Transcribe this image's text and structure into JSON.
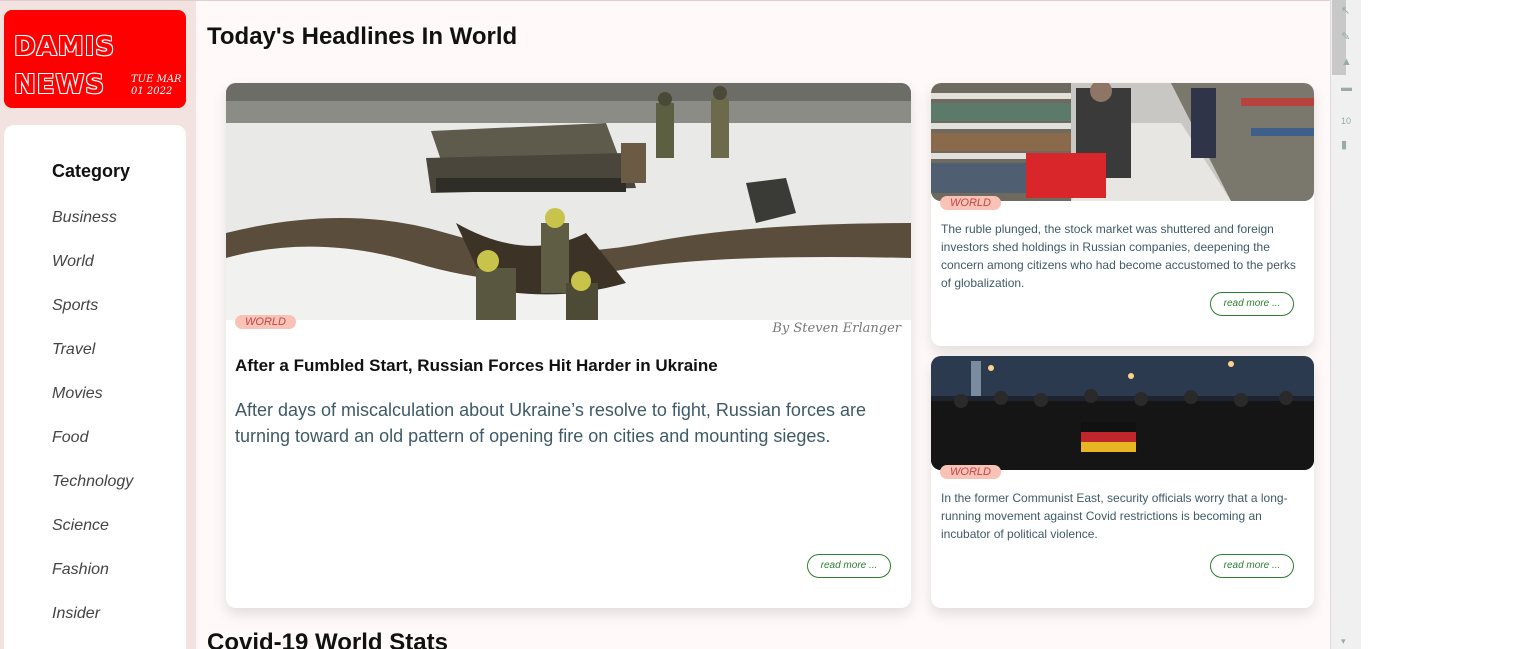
{
  "brand": {
    "line1": "DAMIS",
    "line2": "NEWS",
    "date_line1": "TUE MAR",
    "date_line2": "01 2022",
    "accent": "#ff0000"
  },
  "sidebar": {
    "title": "Category",
    "items": [
      "Business",
      "World",
      "Sports",
      "Travel",
      "Movies",
      "Food",
      "Technology",
      "Science",
      "Fashion",
      "Insider"
    ]
  },
  "main": {
    "heading": "Today's Headlines In World",
    "next_heading": "Covid-19 World Stats",
    "featured": {
      "badge": "WORLD",
      "byline": "By Steven Erlanger",
      "title": "After a Fumbled Start, Russian Forces Hit Harder in Ukraine",
      "summary": "After days of miscalculation about Ukraine’s resolve to fight, Russian forces are turning toward an old pattern of opening fire on cities and mounting sieges.",
      "read_more": "read more ..."
    },
    "side_articles": [
      {
        "badge": "WORLD",
        "summary": "The ruble plunged, the stock market was shuttered and foreign investors shed holdings in Russian companies, deepening the concern among citizens who had become accustomed to the perks of globalization.",
        "read_more": "read more ..."
      },
      {
        "badge": "WORLD",
        "summary": "In the former Communist East, security officials worry that a long-running movement against Covid restrictions is becoming an incubator of political violence.",
        "read_more": "read more ..."
      }
    ]
  },
  "colors": {
    "badge_bg": "#f8c3b6",
    "badge_text": "#c04848",
    "read_more": "#2e7d32",
    "body_text": "#3f5a66",
    "background": "#fffaf9"
  },
  "toolbar": {
    "font_size": "10"
  }
}
